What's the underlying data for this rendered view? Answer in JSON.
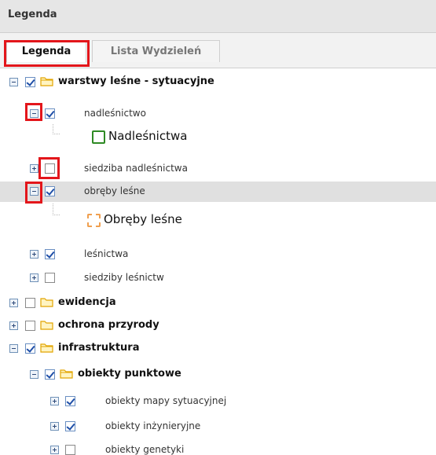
{
  "panel_title": "Legenda",
  "tabs": [
    {
      "label": "Legenda",
      "active": true
    },
    {
      "label": "Lista Wydzieleń",
      "active": false
    }
  ],
  "highlight_color": "#e3161b",
  "tree": {
    "warstwy": {
      "label": "warstwy leśne - sytuacyjne",
      "checked": true,
      "expanded": true
    },
    "nadlesnictwo": {
      "label": "nadleśnictwo",
      "checked": true,
      "expanded": true,
      "legend": "Nadleśnictwa",
      "legend_color": "#2f8a24"
    },
    "siedziba_nadl": {
      "label": "siedziba nadleśnictwa",
      "checked": false,
      "expanded": false
    },
    "obreby": {
      "label": "obręby leśne",
      "checked": true,
      "expanded": true,
      "legend": "Obręby leśne",
      "legend_color": "#f0a050"
    },
    "lesnictwa": {
      "label": "leśnictwa",
      "checked": true,
      "expanded": false
    },
    "siedziby_lesn": {
      "label": "siedziby leśnictw",
      "checked": false,
      "expanded": false
    },
    "ewidencja": {
      "label": "ewidencja",
      "checked": false,
      "expanded": false
    },
    "ochrona": {
      "label": "ochrona przyrody",
      "checked": false,
      "expanded": false
    },
    "infrastruktura": {
      "label": "infrastruktura",
      "checked": true,
      "expanded": true
    },
    "obiekty_punktowe": {
      "label": "obiekty punktowe",
      "checked": true,
      "expanded": true
    },
    "mapy_sytuacyjnej": {
      "label": "obiekty mapy sytuacyjnej",
      "checked": true,
      "expanded": false
    },
    "inzynieryjne": {
      "label": "obiekty inżynieryjne",
      "checked": true,
      "expanded": false
    },
    "genetyki": {
      "label": "obiekty genetyki",
      "checked": false,
      "expanded": false
    }
  }
}
